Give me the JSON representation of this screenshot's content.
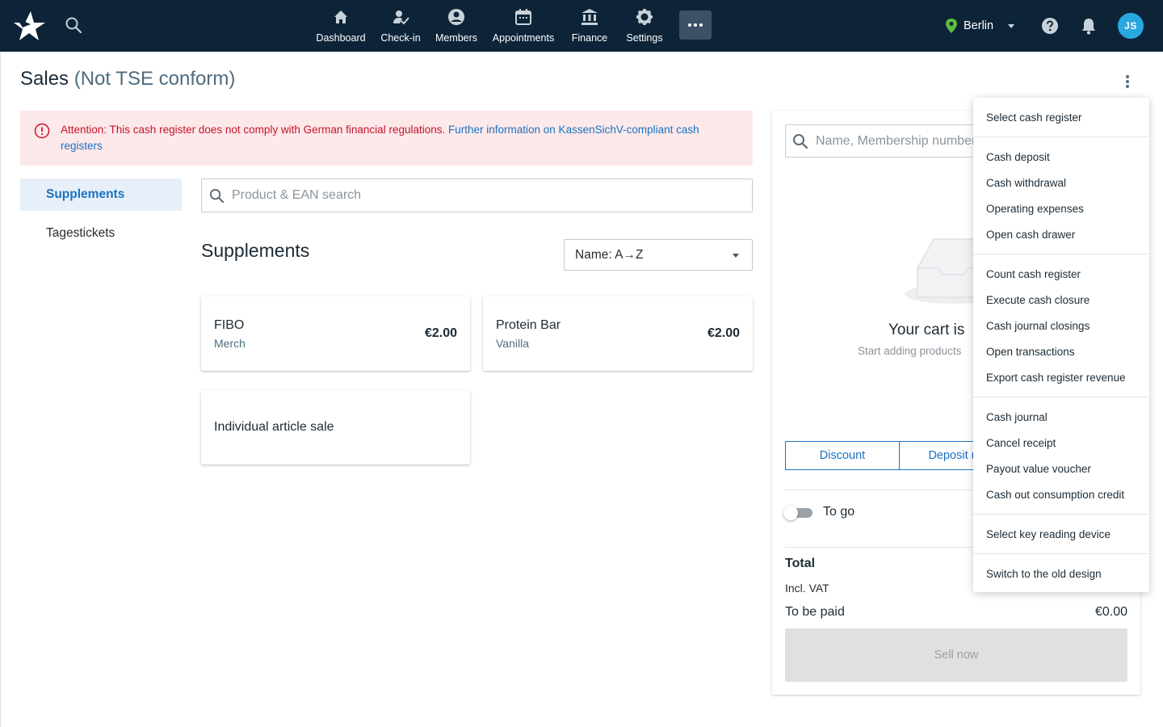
{
  "nav": {
    "items": [
      {
        "label": "Dashboard",
        "icon": "home-icon"
      },
      {
        "label": "Check-in",
        "icon": "person-check-icon"
      },
      {
        "label": "Members",
        "icon": "account-circle-icon"
      },
      {
        "label": "Appointments",
        "icon": "calendar-icon"
      },
      {
        "label": "Finance",
        "icon": "bank-icon"
      },
      {
        "label": "Settings",
        "icon": "gear-icon"
      }
    ]
  },
  "header": {
    "location": "Berlin",
    "avatar_initials": "JS"
  },
  "page": {
    "title": "Sales",
    "title_note": "(Not TSE conform)"
  },
  "alert": {
    "text": "Attention: This cash register does not comply with German financial regulations. ",
    "link": "Further information on KassenSichV-compliant cash registers"
  },
  "categories": [
    {
      "label": "Supplements",
      "active": true
    },
    {
      "label": "Tagestickets",
      "active": false
    }
  ],
  "product_search": {
    "placeholder": "Product & EAN search",
    "value": ""
  },
  "section": {
    "title": "Supplements"
  },
  "sort": {
    "selected": "Name: A→Z"
  },
  "products": [
    {
      "name": "FIBO",
      "sub": "Merch",
      "price": "€2.00"
    },
    {
      "name": "Protein Bar",
      "sub": "Vanilla",
      "price": "€2.00"
    },
    {
      "name": "Individual article sale"
    }
  ],
  "cart": {
    "search_placeholder": "Name, Membership number",
    "empty_title": "Your cart is",
    "empty_sub": "Start adding products",
    "discount_label": "Discount",
    "deposit_label": "Deposit ref",
    "togo_label": "To go",
    "total_label": "Total",
    "vat_label": "Incl. VAT",
    "paid_label": "To be paid",
    "paid_value": "€0.00",
    "sell_label": "Sell now"
  },
  "menu": {
    "groups": [
      [
        "Select cash register"
      ],
      [
        "Cash deposit",
        "Cash withdrawal",
        "Operating expenses",
        "Open cash drawer"
      ],
      [
        "Count cash register",
        "Execute cash closure",
        "Cash journal closings",
        "Open transactions",
        "Export cash register revenue"
      ],
      [
        "Cash journal",
        "Cancel receipt",
        "Payout value voucher",
        "Cash out consumption credit"
      ],
      [
        "Select key reading device"
      ],
      [
        "Switch to the old design"
      ]
    ]
  },
  "colors": {
    "topbar": "#0d2438",
    "accent": "#1a73c0",
    "alert_bg": "#fde8ea",
    "alert_text": "#c4162a",
    "avatar": "#29a8e0"
  }
}
